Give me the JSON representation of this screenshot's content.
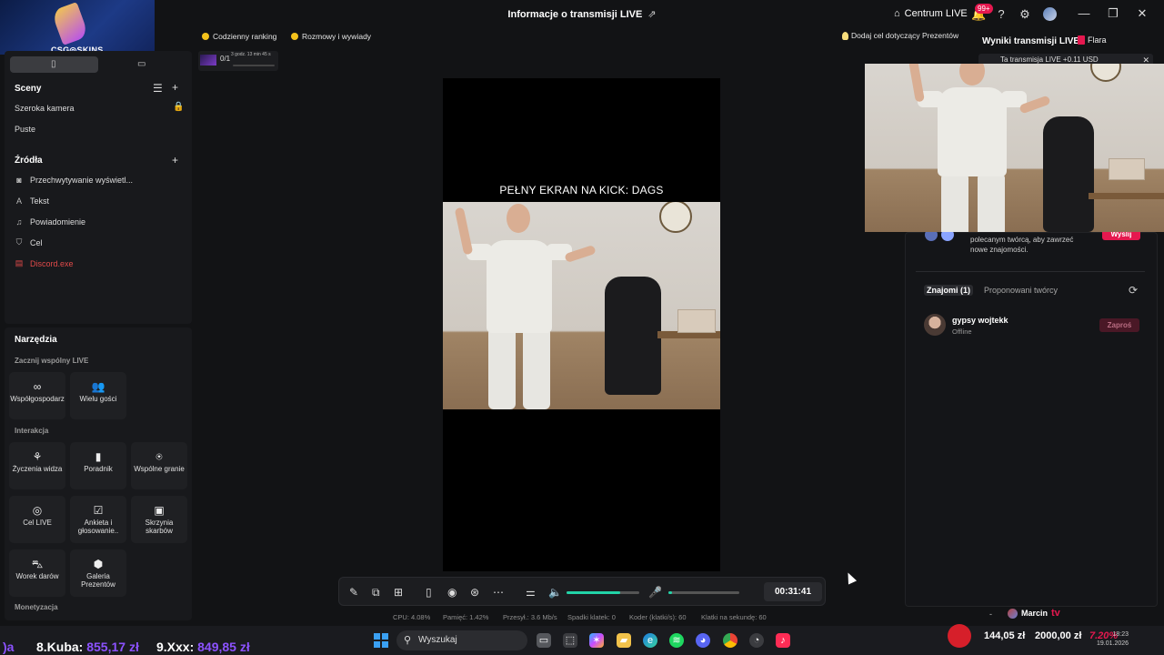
{
  "window": {
    "title": "Informacje o transmisji LIVE",
    "centrum_label": "Centrum LIVE",
    "notif_count": "99+"
  },
  "branding": {
    "logo_text": "CSG◎SKINS"
  },
  "top_pills": {
    "ranking": "Codzienny ranking",
    "talks": "Rozmowy i wywiady",
    "goal": "Dodaj cel dotyczący Prezentów"
  },
  "mini_status": {
    "fraction": "0/1",
    "time": "3 godz. 13 min 45 s"
  },
  "scenes": {
    "header": "Sceny",
    "items": [
      "Szeroka kamera",
      "Puste"
    ]
  },
  "sources": {
    "header": "Źródła",
    "items": [
      "Przechwytywanie wyświetl...",
      "Tekst",
      "Powiadomienie",
      "Cel",
      "Discord.exe"
    ]
  },
  "tools": {
    "header": "Narzędzia",
    "co_live_header": "Zacznij wspólny LIVE",
    "co_live": [
      "Współgospodarz",
      "Wielu gości"
    ],
    "interaction_header": "Interakcja",
    "interaction": [
      "Życzenia widza",
      "Poradnik",
      "Wspólne granie",
      "Cel LIVE",
      "Ankieta i głosowanie..",
      "Skrzynia skarbów",
      "Worek darów",
      "Galeria Prezentów"
    ],
    "monetization_header": "Monetyzacja"
  },
  "preview": {
    "caption": "PEŁNY EKRAN NA KICK: DAGS"
  },
  "controls": {
    "timer": "00:31:41",
    "volume_level": 0.74,
    "mic_level": 0.05
  },
  "stats": {
    "cpu": "CPU: 4.08%",
    "memory": "Pamięć: 1.42%",
    "bandwidth": "Przesył.: 3.6 Mb/s",
    "dropped": "Spadki klatek: 0",
    "encoder": "Koder (klatki/s): 60",
    "fps": "Klatki na sekundę: 60"
  },
  "right_panel": {
    "title": "Wyniki transmisji LIVE",
    "flara": "Flara",
    "earnings": "Ta transmisja LIVE +0.11 USD",
    "rec_text_1": "polecanym twórcą, aby zawrzeć",
    "rec_text_2": "nowe znajomości.",
    "send_label": "Wyślij",
    "tab_friends": "Znajomi (1)",
    "tab_suggested": "Proponowani twórcy",
    "friend_name": "gypsy wojtekk",
    "friend_status": "Offline",
    "invite_label": "Zaproś",
    "bottom_user": "Marcin",
    "bottom_tv": "tv",
    "dash": "-"
  },
  "ticker": {
    "prefix": ")a",
    "entry1_name": "8.Kuba:",
    "entry1_amount": "855,17 zł",
    "entry2_name": "9.Xxx:",
    "entry2_amount": "849,85 zł"
  },
  "taskbar": {
    "search": "Wyszukaj",
    "amount1": "144,05 zł",
    "amount2": "2000,00 zł",
    "percent": "7.20%",
    "time": "18:23",
    "date": "19.01.2026"
  }
}
